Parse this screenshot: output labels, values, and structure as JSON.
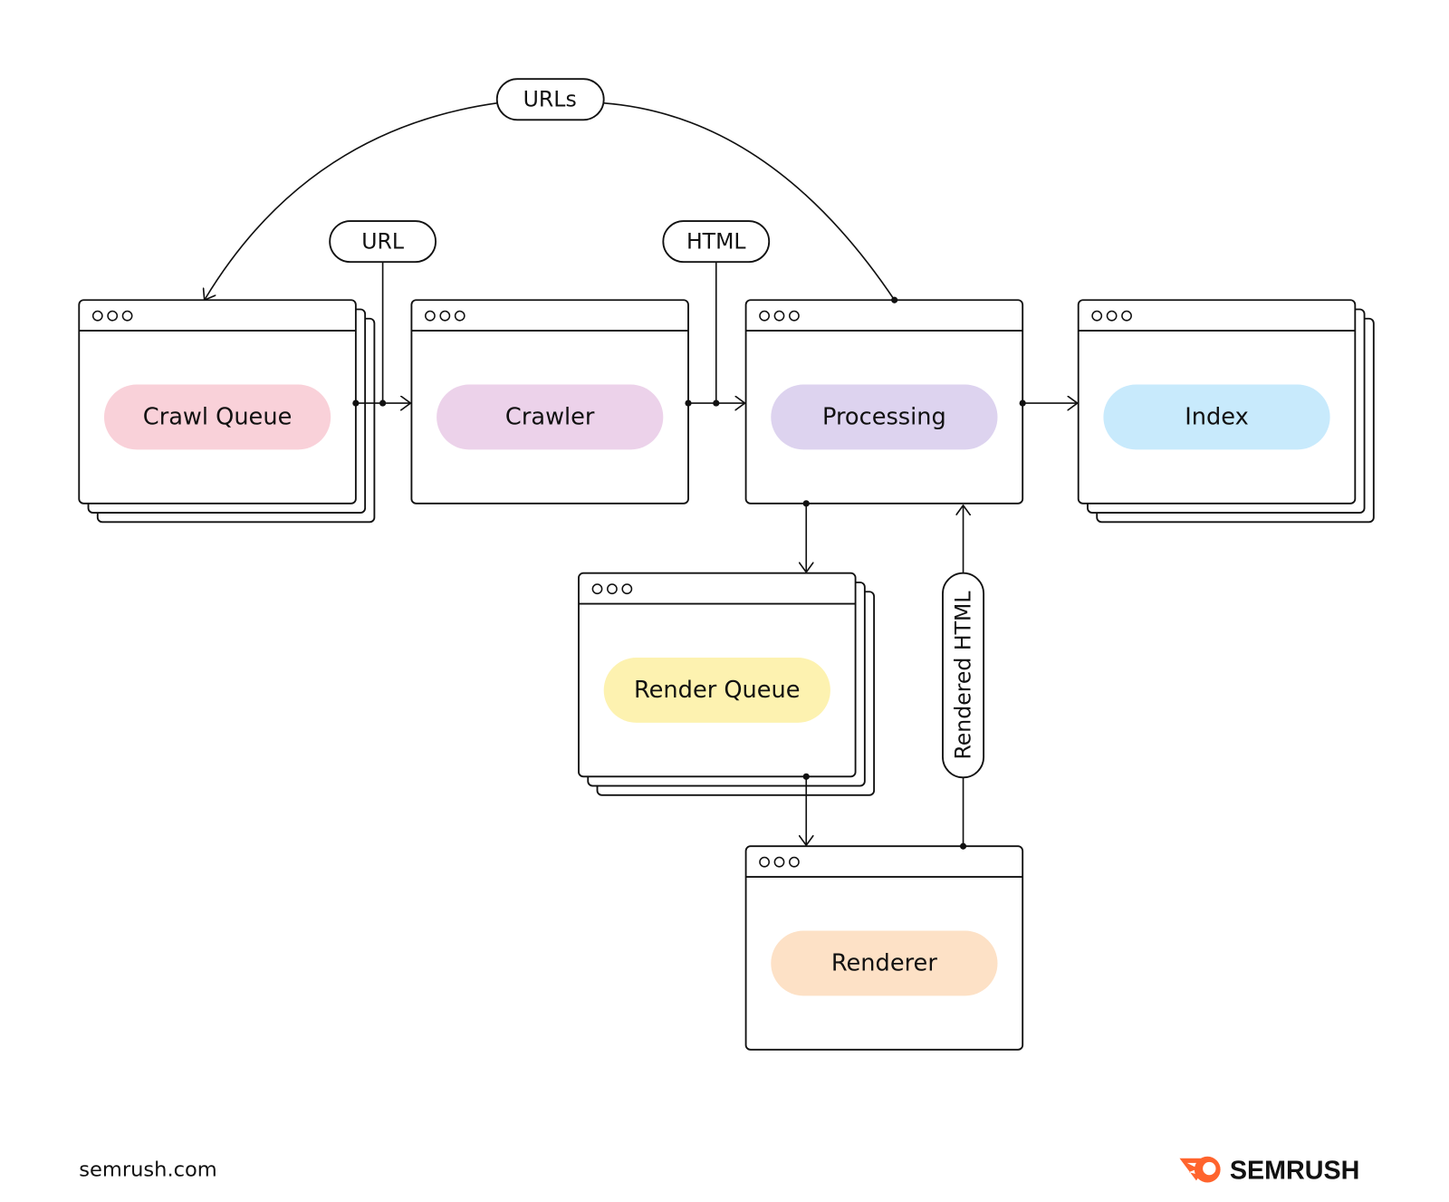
{
  "nodes": {
    "crawl_queue": {
      "label": "Crawl Queue",
      "color": "#f9d1d9",
      "stacked": true
    },
    "crawler": {
      "label": "Crawler",
      "color": "#ecd2ea",
      "stacked": false
    },
    "processing": {
      "label": "Processing",
      "color": "#ddd3ef",
      "stacked": false
    },
    "index": {
      "label": "Index",
      "color": "#c8eafc",
      "stacked": true
    },
    "render_queue": {
      "label": "Render Queue",
      "color": "#fdf2b0",
      "stacked": true
    },
    "renderer": {
      "label": "Renderer",
      "color": "#fde1c6",
      "stacked": false
    }
  },
  "edges": {
    "urls": "URLs",
    "url": "URL",
    "html": "HTML",
    "rendered_html": "Rendered HTML"
  },
  "footer": {
    "site": "semrush.com",
    "brand": "SEMRUSH",
    "brand_color": "#ff642d"
  }
}
